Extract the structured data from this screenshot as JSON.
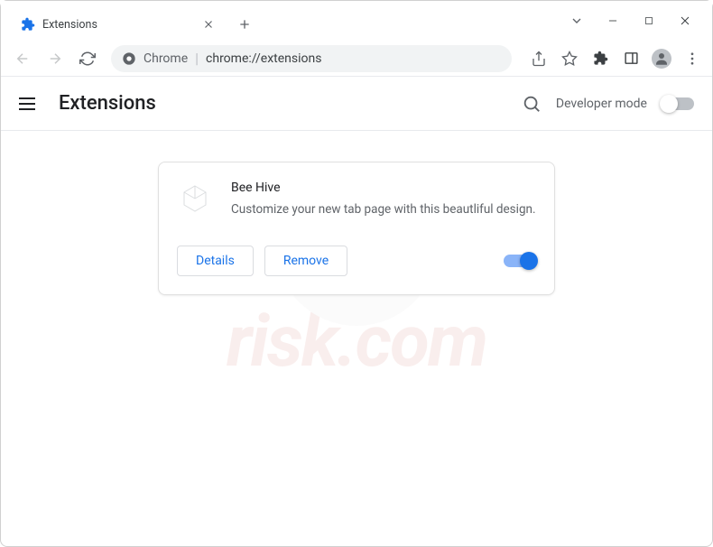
{
  "window": {
    "tab_title": "Extensions"
  },
  "omnibox": {
    "scheme_label": "Chrome",
    "url": "chrome://extensions"
  },
  "page": {
    "title": "Extensions",
    "developer_mode_label": "Developer mode"
  },
  "extension": {
    "name": "Bee Hive",
    "description": "Customize your new tab page with this beautliful design.",
    "details_label": "Details",
    "remove_label": "Remove",
    "enabled": true
  },
  "watermark": {
    "text": "risk.com"
  }
}
